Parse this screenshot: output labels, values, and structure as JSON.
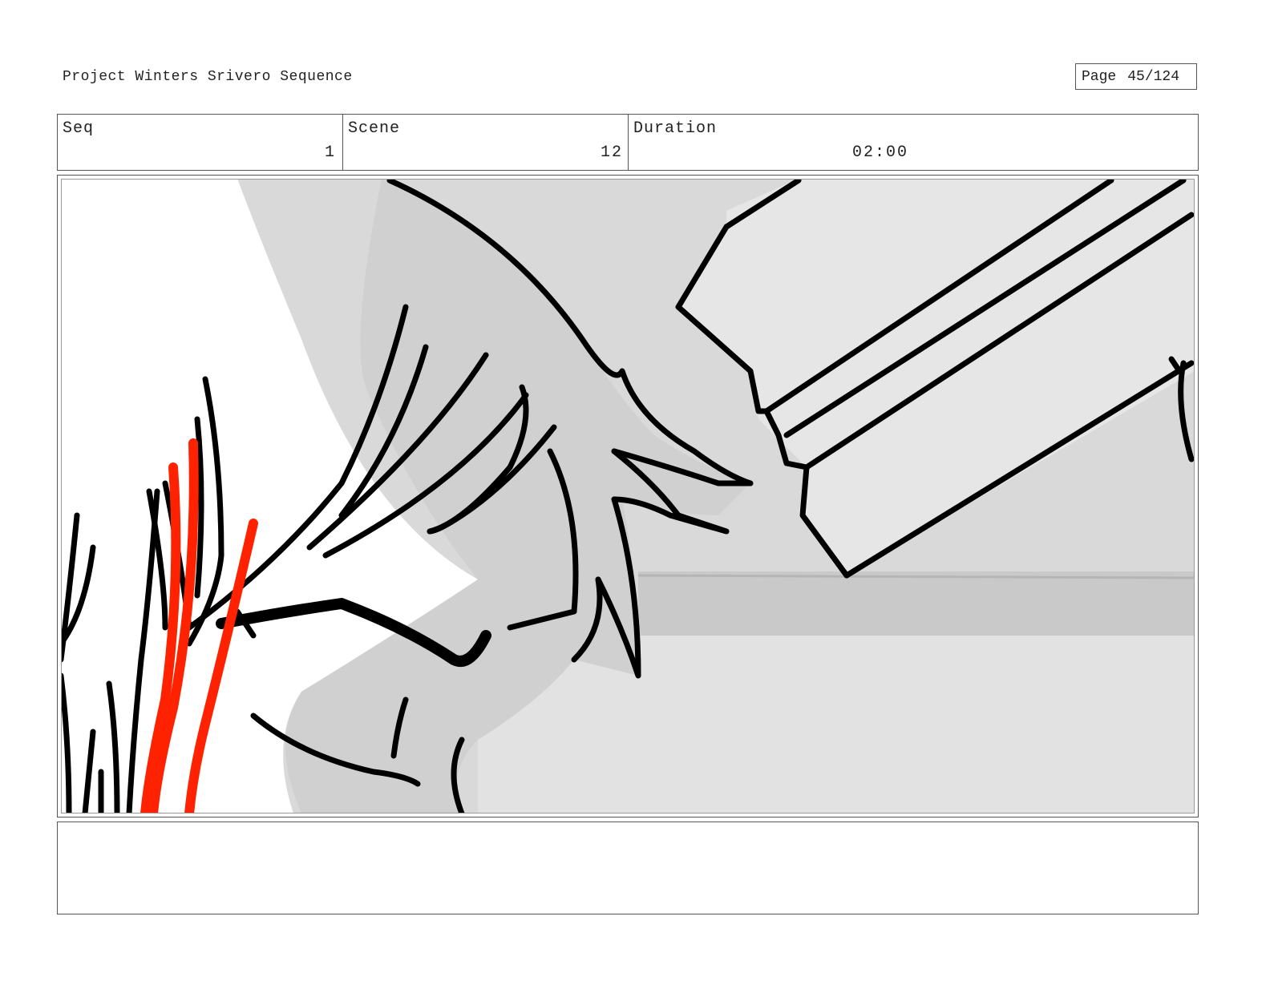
{
  "header": {
    "project_title": "Project Winters Srivero Sequence",
    "page_label": "Page",
    "page_value": "45/124"
  },
  "info": {
    "seq_label": "Seq",
    "seq_value": "1",
    "scene_label": "Scene",
    "scene_value": "12",
    "duration_label": "Duration",
    "duration_value": "02:00"
  },
  "panel": {
    "accent_color": "#ff2200",
    "line_color": "#000000",
    "fill_light": "#e3e3e3",
    "fill_mid": "#cfcfcf"
  },
  "notes": {
    "text": ""
  }
}
